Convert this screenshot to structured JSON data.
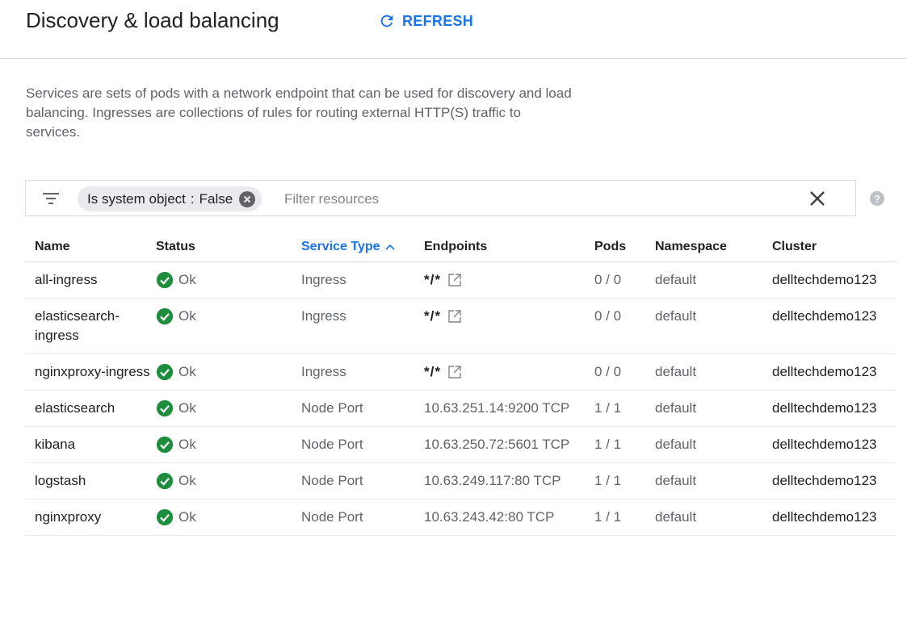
{
  "header": {
    "title": "Discovery & load balancing",
    "refresh_label": "REFRESH",
    "accent": "#1a73e8"
  },
  "description": "Services are sets of pods with a network endpoint that can be used for discovery and load balancing. Ingresses are collections of rules for routing external HTTP(S) traffic to services.",
  "filter": {
    "chip_key": "Is system object",
    "chip_sep": ":",
    "chip_value": "False",
    "placeholder": "Filter resources",
    "icons": [
      "filter-list-icon",
      "cancel-chip-icon",
      "close-icon",
      "help-icon"
    ]
  },
  "table": {
    "columns": [
      "Name",
      "Status",
      "Service Type",
      "Endpoints",
      "Pods",
      "Namespace",
      "Cluster"
    ],
    "sorted_column": "Service Type",
    "rows": [
      {
        "name": "all-ingress",
        "status": "Ok",
        "type": "Ingress",
        "endpoint": "*/*",
        "endpoint_link": true,
        "pods": "0 / 0",
        "namespace": "default",
        "cluster": "delltechdemo123"
      },
      {
        "name": "elasticsearch-ingress",
        "status": "Ok",
        "type": "Ingress",
        "endpoint": "*/*",
        "endpoint_link": true,
        "pods": "0 / 0",
        "namespace": "default",
        "cluster": "delltechdemo123"
      },
      {
        "name": "nginxproxy-ingress",
        "status": "Ok",
        "type": "Ingress",
        "endpoint": "*/*",
        "endpoint_link": true,
        "pods": "0 / 0",
        "namespace": "default",
        "cluster": "delltechdemo123"
      },
      {
        "name": "elasticsearch",
        "status": "Ok",
        "type": "Node Port",
        "endpoint": "10.63.251.14:9200 TCP",
        "endpoint_link": false,
        "pods": "1 / 1",
        "namespace": "default",
        "cluster": "delltechdemo123"
      },
      {
        "name": "kibana",
        "status": "Ok",
        "type": "Node Port",
        "endpoint": "10.63.250.72:5601 TCP",
        "endpoint_link": false,
        "pods": "1 / 1",
        "namespace": "default",
        "cluster": "delltechdemo123"
      },
      {
        "name": "logstash",
        "status": "Ok",
        "type": "Node Port",
        "endpoint": "10.63.249.117:80 TCP",
        "endpoint_link": false,
        "pods": "1 / 1",
        "namespace": "default",
        "cluster": "delltechdemo123"
      },
      {
        "name": "nginxproxy",
        "status": "Ok",
        "type": "Node Port",
        "endpoint": "10.63.243.42:80 TCP",
        "endpoint_link": false,
        "pods": "1 / 1",
        "namespace": "default",
        "cluster": "delltechdemo123"
      }
    ],
    "status_color": "#1e8e3e"
  }
}
